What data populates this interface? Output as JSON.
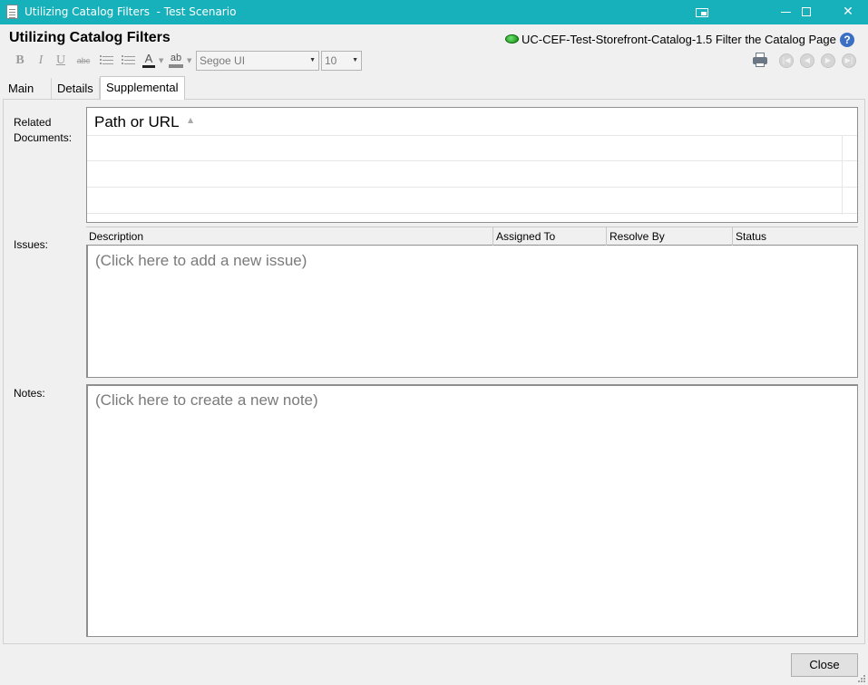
{
  "window": {
    "title": "Utilizing Catalog Filters  - Test Scenario",
    "restore_icon": "window-restore-icon",
    "close_glyph": "✕"
  },
  "header": {
    "title": "Utilizing Catalog Filters",
    "scenario_id": "UC-CEF-Test-Storefront-Catalog-1.5 Filter the Catalog Page",
    "status_color": "#11a011",
    "help_glyph": "?"
  },
  "toolbar": {
    "bold": "B",
    "italic": "I",
    "underline": "U",
    "strike": "abc",
    "font_color_glyph": "A",
    "highlight_glyph": "ab",
    "font_name": "Segoe UI",
    "font_size": "10"
  },
  "tabs": [
    {
      "label": "Main",
      "selected": false
    },
    {
      "label": "Details",
      "selected": false
    },
    {
      "label": "Supplemental",
      "selected": true
    }
  ],
  "related_documents": {
    "label": "Related Documents:",
    "column_header": "Path or URL"
  },
  "issues": {
    "label": "Issues:",
    "columns": [
      "Description",
      "Assigned To",
      "Resolve By",
      "Status"
    ],
    "placeholder": "(Click here to add a new issue)"
  },
  "notes": {
    "label": "Notes:",
    "placeholder": "(Click here to create a new note)"
  },
  "footer": {
    "close_label": "Close"
  },
  "colors": {
    "titlebar": "#17b1bb",
    "background": "#f0f0f0"
  }
}
